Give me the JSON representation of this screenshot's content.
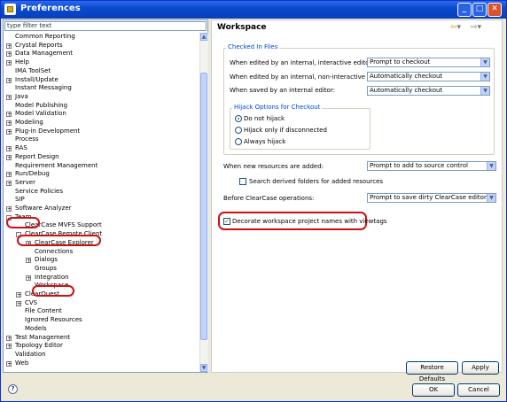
{
  "window": {
    "title": "Preferences",
    "controls": {
      "minimize": "_",
      "maximize": "□",
      "close": "✕"
    }
  },
  "filter": {
    "placeholder": "type filter text"
  },
  "tree": [
    {
      "label": "Common Reporting",
      "expander": "none"
    },
    {
      "label": "Crystal Reports",
      "expander": "+"
    },
    {
      "label": "Data Management",
      "expander": "+"
    },
    {
      "label": "Help",
      "expander": "+"
    },
    {
      "label": "IMA ToolSet",
      "expander": "none"
    },
    {
      "label": "Install/Update",
      "expander": "+"
    },
    {
      "label": "Instant Messaging",
      "expander": "none"
    },
    {
      "label": "Java",
      "expander": "+"
    },
    {
      "label": "Model Publishing",
      "expander": "none"
    },
    {
      "label": "Model Validation",
      "expander": "+"
    },
    {
      "label": "Modeling",
      "expander": "+"
    },
    {
      "label": "Plug-in Development",
      "expander": "+"
    },
    {
      "label": "Process",
      "expander": "none"
    },
    {
      "label": "RAS",
      "expander": "+"
    },
    {
      "label": "Report Design",
      "expander": "+"
    },
    {
      "label": "Requirement Management",
      "expander": "none"
    },
    {
      "label": "Run/Debug",
      "expander": "+"
    },
    {
      "label": "Server",
      "expander": "+"
    },
    {
      "label": "Service Policies",
      "expander": "none"
    },
    {
      "label": "SIP",
      "expander": "none"
    },
    {
      "label": "Software Analyzer",
      "expander": "+"
    },
    {
      "label": "Team",
      "expander": "-"
    },
    {
      "label": "ClearCase MVFS Support",
      "expander": "none"
    },
    {
      "label": "ClearCase Remote Client",
      "expander": "-"
    },
    {
      "label": "ClearCase Explorer",
      "expander": "+"
    },
    {
      "label": "Connections",
      "expander": "none"
    },
    {
      "label": "Dialogs",
      "expander": "+"
    },
    {
      "label": "Groups",
      "expander": "none"
    },
    {
      "label": "Integration",
      "expander": "+"
    },
    {
      "label": "Workspace",
      "expander": "none"
    },
    {
      "label": "ClearQuest",
      "expander": "+"
    },
    {
      "label": "CVS",
      "expander": "+"
    },
    {
      "label": "File Content",
      "expander": "none"
    },
    {
      "label": "Ignored Resources",
      "expander": "none"
    },
    {
      "label": "Models",
      "expander": "none"
    },
    {
      "label": "Test Management",
      "expander": "+"
    },
    {
      "label": "Topology Editor",
      "expander": "+"
    },
    {
      "label": "Validation",
      "expander": "none"
    },
    {
      "label": "Web",
      "expander": "+"
    }
  ],
  "page": {
    "title": "Workspace",
    "checked_in_files": {
      "legend": "Checked In Files",
      "rows": [
        {
          "label": "When edited by an internal, interactive editor:",
          "value": "Prompt to checkout"
        },
        {
          "label": "When edited by an internal, non-interactive editor:",
          "value": "Automatically checkout"
        },
        {
          "label": "When saved by an internal editor:",
          "value": "Automatically checkout"
        }
      ],
      "hijack": {
        "legend": "Hijack Options for Checkout",
        "options": [
          "Do not hijack",
          "Hijack only if disconnected",
          "Always hijack"
        ],
        "selected": "Do not hijack"
      }
    },
    "new_resources": {
      "label": "When new resources are added:",
      "value": "Prompt to add to source control"
    },
    "search_derived": {
      "label": "Search derived folders for added resources",
      "checked": false
    },
    "before_ops": {
      "label": "Before ClearCase operations:",
      "value": "Prompt to save dirty ClearCase editors"
    },
    "decorate": {
      "label": "Decorate workspace project names with viewtags",
      "checked": true
    },
    "restore_label": "Restore Defaults",
    "apply_label": "Apply"
  },
  "footer": {
    "help": "?",
    "ok_label": "OK",
    "cancel_label": "Cancel"
  },
  "colors": {
    "highlight": "#d01010",
    "group_label": "#0046d5",
    "titlebar": "#0a4ad0"
  }
}
